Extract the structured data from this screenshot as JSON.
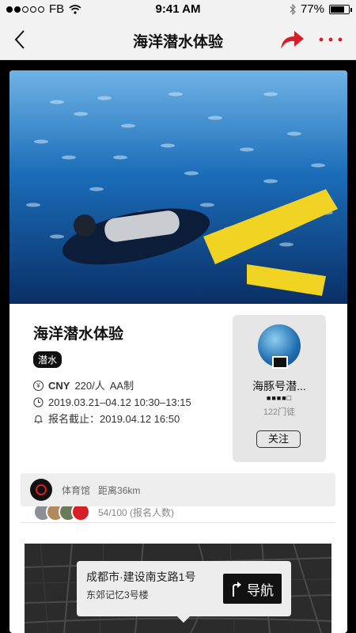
{
  "status_bar": {
    "carrier": "FB",
    "time": "9:41 AM",
    "battery": "77%",
    "signal_bars": 2,
    "battery_level": 0.77
  },
  "nav": {
    "title": "海洋潜水体验"
  },
  "event": {
    "title": "海洋潜水体验",
    "tag": "潜水",
    "currency": "CNY",
    "price": "220/人",
    "payment": "AA制",
    "dates": "2019.03.21–04.12 10:30–13:15",
    "deadline": "报名截止：2019.04.12 16:50",
    "participants": "54/100 (报名人数)"
  },
  "club": {
    "name": "海豚号潜...",
    "fans": "122门徒",
    "follow_label": "关注",
    "rating": 4,
    "rating_max": 5
  },
  "venue": {
    "name": "体育馆",
    "distance": "距离36km"
  },
  "map": {
    "address_line1": "成都市·建设南支路1号",
    "address_line2": "东郊记忆3号楼",
    "nav_label": "导航"
  },
  "colors": {
    "accent": "#d71f28",
    "background": "#000000",
    "nav_bg": "#f2f2f2"
  }
}
